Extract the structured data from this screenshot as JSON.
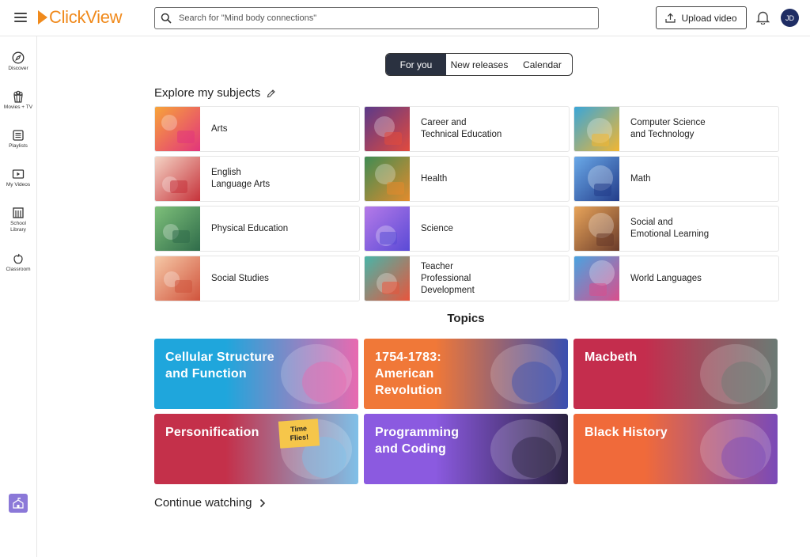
{
  "app": {
    "logo_text": "ClickView"
  },
  "header": {
    "search_placeholder": "Search for \"Mind body connections\"",
    "upload_label": "Upload video",
    "avatar_initials": "JD"
  },
  "sidebar": {
    "items": [
      {
        "label": "Discover",
        "icon": "compass-icon"
      },
      {
        "label": "Movies + TV",
        "icon": "popcorn-icon"
      },
      {
        "label": "Playlists",
        "icon": "playlist-icon"
      },
      {
        "label": "My Videos",
        "icon": "video-icon"
      },
      {
        "label": "School Library",
        "icon": "library-icon"
      },
      {
        "label": "Classroom",
        "icon": "apple-icon"
      }
    ]
  },
  "tabs": [
    {
      "label": "For you",
      "active": true
    },
    {
      "label": "New releases",
      "active": false
    },
    {
      "label": "Calendar",
      "active": false
    }
  ],
  "explore": {
    "title": "Explore my subjects",
    "subjects": [
      {
        "label": "Arts",
        "colors": [
          "#f7a43a",
          "#e2347c"
        ]
      },
      {
        "label": "Career and\nTechnical Education",
        "colors": [
          "#5b3a8a",
          "#e24a3d"
        ]
      },
      {
        "label": "Computer Science\nand Technology",
        "colors": [
          "#3aa6d8",
          "#f2b631"
        ]
      },
      {
        "label": "English\nLanguage Arts",
        "colors": [
          "#f4d3c4",
          "#c6323a"
        ]
      },
      {
        "label": "Health",
        "colors": [
          "#3f8c54",
          "#e38b2c"
        ]
      },
      {
        "label": "Math",
        "colors": [
          "#6aa9e8",
          "#233c8a"
        ]
      },
      {
        "label": "Physical Education",
        "colors": [
          "#7ec07a",
          "#2f6c4a"
        ]
      },
      {
        "label": "Science",
        "colors": [
          "#b57ae8",
          "#5a4ad6"
        ]
      },
      {
        "label": "Social and\nEmotional Learning",
        "colors": [
          "#e8a45a",
          "#6a3b2a"
        ]
      },
      {
        "label": "Social Studies",
        "colors": [
          "#f6c9a7",
          "#d0533c"
        ]
      },
      {
        "label": "Teacher\nProfessional\nDevelopment",
        "colors": [
          "#48b5a8",
          "#e8553c"
        ]
      },
      {
        "label": "World Languages",
        "colors": [
          "#4aa3e0",
          "#d94f8c"
        ]
      }
    ]
  },
  "topics": {
    "title": "Topics",
    "items": [
      {
        "label": "Cellular Structure\nand Function",
        "colors": [
          "#1fa6dc",
          "#e86ab0"
        ]
      },
      {
        "label": "1754-1783:\nAmerican\nRevolution",
        "colors": [
          "#f07838",
          "#3a4fb0"
        ]
      },
      {
        "label": "Macbeth",
        "colors": [
          "#c42d4d",
          "#6b7a74"
        ]
      },
      {
        "label": "Personification",
        "colors": [
          "#c4304a",
          "#7fc0e8"
        ],
        "badge": "Time\nFlies!"
      },
      {
        "label": "Programming\nand Coding",
        "colors": [
          "#8b5ae0",
          "#2a2240"
        ]
      },
      {
        "label": "Black History",
        "colors": [
          "#f06a3a",
          "#7a4ab8"
        ]
      }
    ]
  },
  "continue_watching": {
    "label": "Continue watching"
  }
}
